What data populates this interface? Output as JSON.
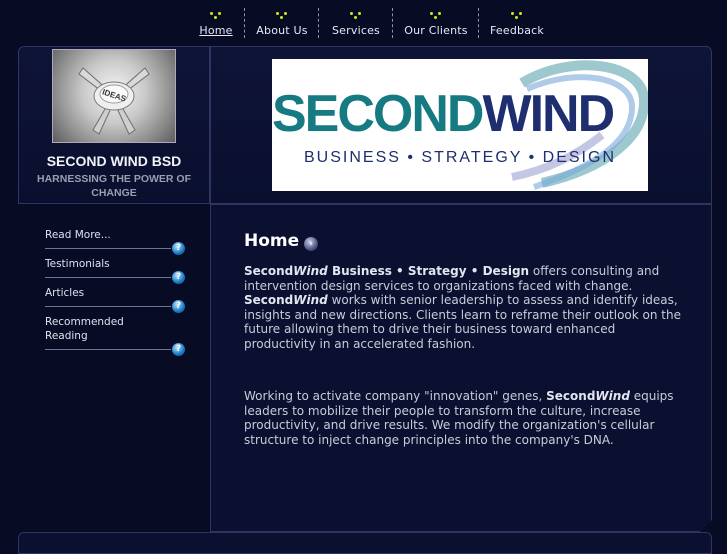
{
  "nav": {
    "items": [
      {
        "label": "Home",
        "active": true
      },
      {
        "label": "About Us"
      },
      {
        "label": "Services"
      },
      {
        "label": "Our Clients"
      },
      {
        "label": "Feedback"
      }
    ]
  },
  "logo": {
    "image_text": "IDEAS",
    "title": "SECOND WIND BSD",
    "tagline": "HARNESSING THE POWER OF CHANGE"
  },
  "banner": {
    "brand_second": "SECOND",
    "brand_wind": "WIND",
    "subtitle": "BUSINESS • STRATEGY • DESIGN"
  },
  "sidebar": {
    "items": [
      {
        "label": "Read More..."
      },
      {
        "label": "Testimonials"
      },
      {
        "label": "Articles"
      },
      {
        "label": "Recommended Reading"
      }
    ]
  },
  "content": {
    "title": "Home",
    "p1_a": "Second",
    "p1_b": "Wind",
    "p1_c": " Business • Strategy • Design",
    "p1_d": " offers consulting and intervention design services to organizations faced with change. ",
    "p1_e": "Second",
    "p1_f": "Wind",
    "p1_g": " works with senior leadership to assess and identify ideas, insights and new directions.  Clients learn to reframe their outlook on the future allowing them to drive their business toward enhanced productivity in an accelerated fashion.",
    "p2_a": "Working to activate company \"innovation\" genes, ",
    "p2_b": "Second",
    "p2_c": "Wind",
    "p2_d": " equips leaders to mobilize their people to transform the culture, increase productivity, and drive results.   We modify the organization's cellular structure to inject change principles into the company's DNA."
  }
}
